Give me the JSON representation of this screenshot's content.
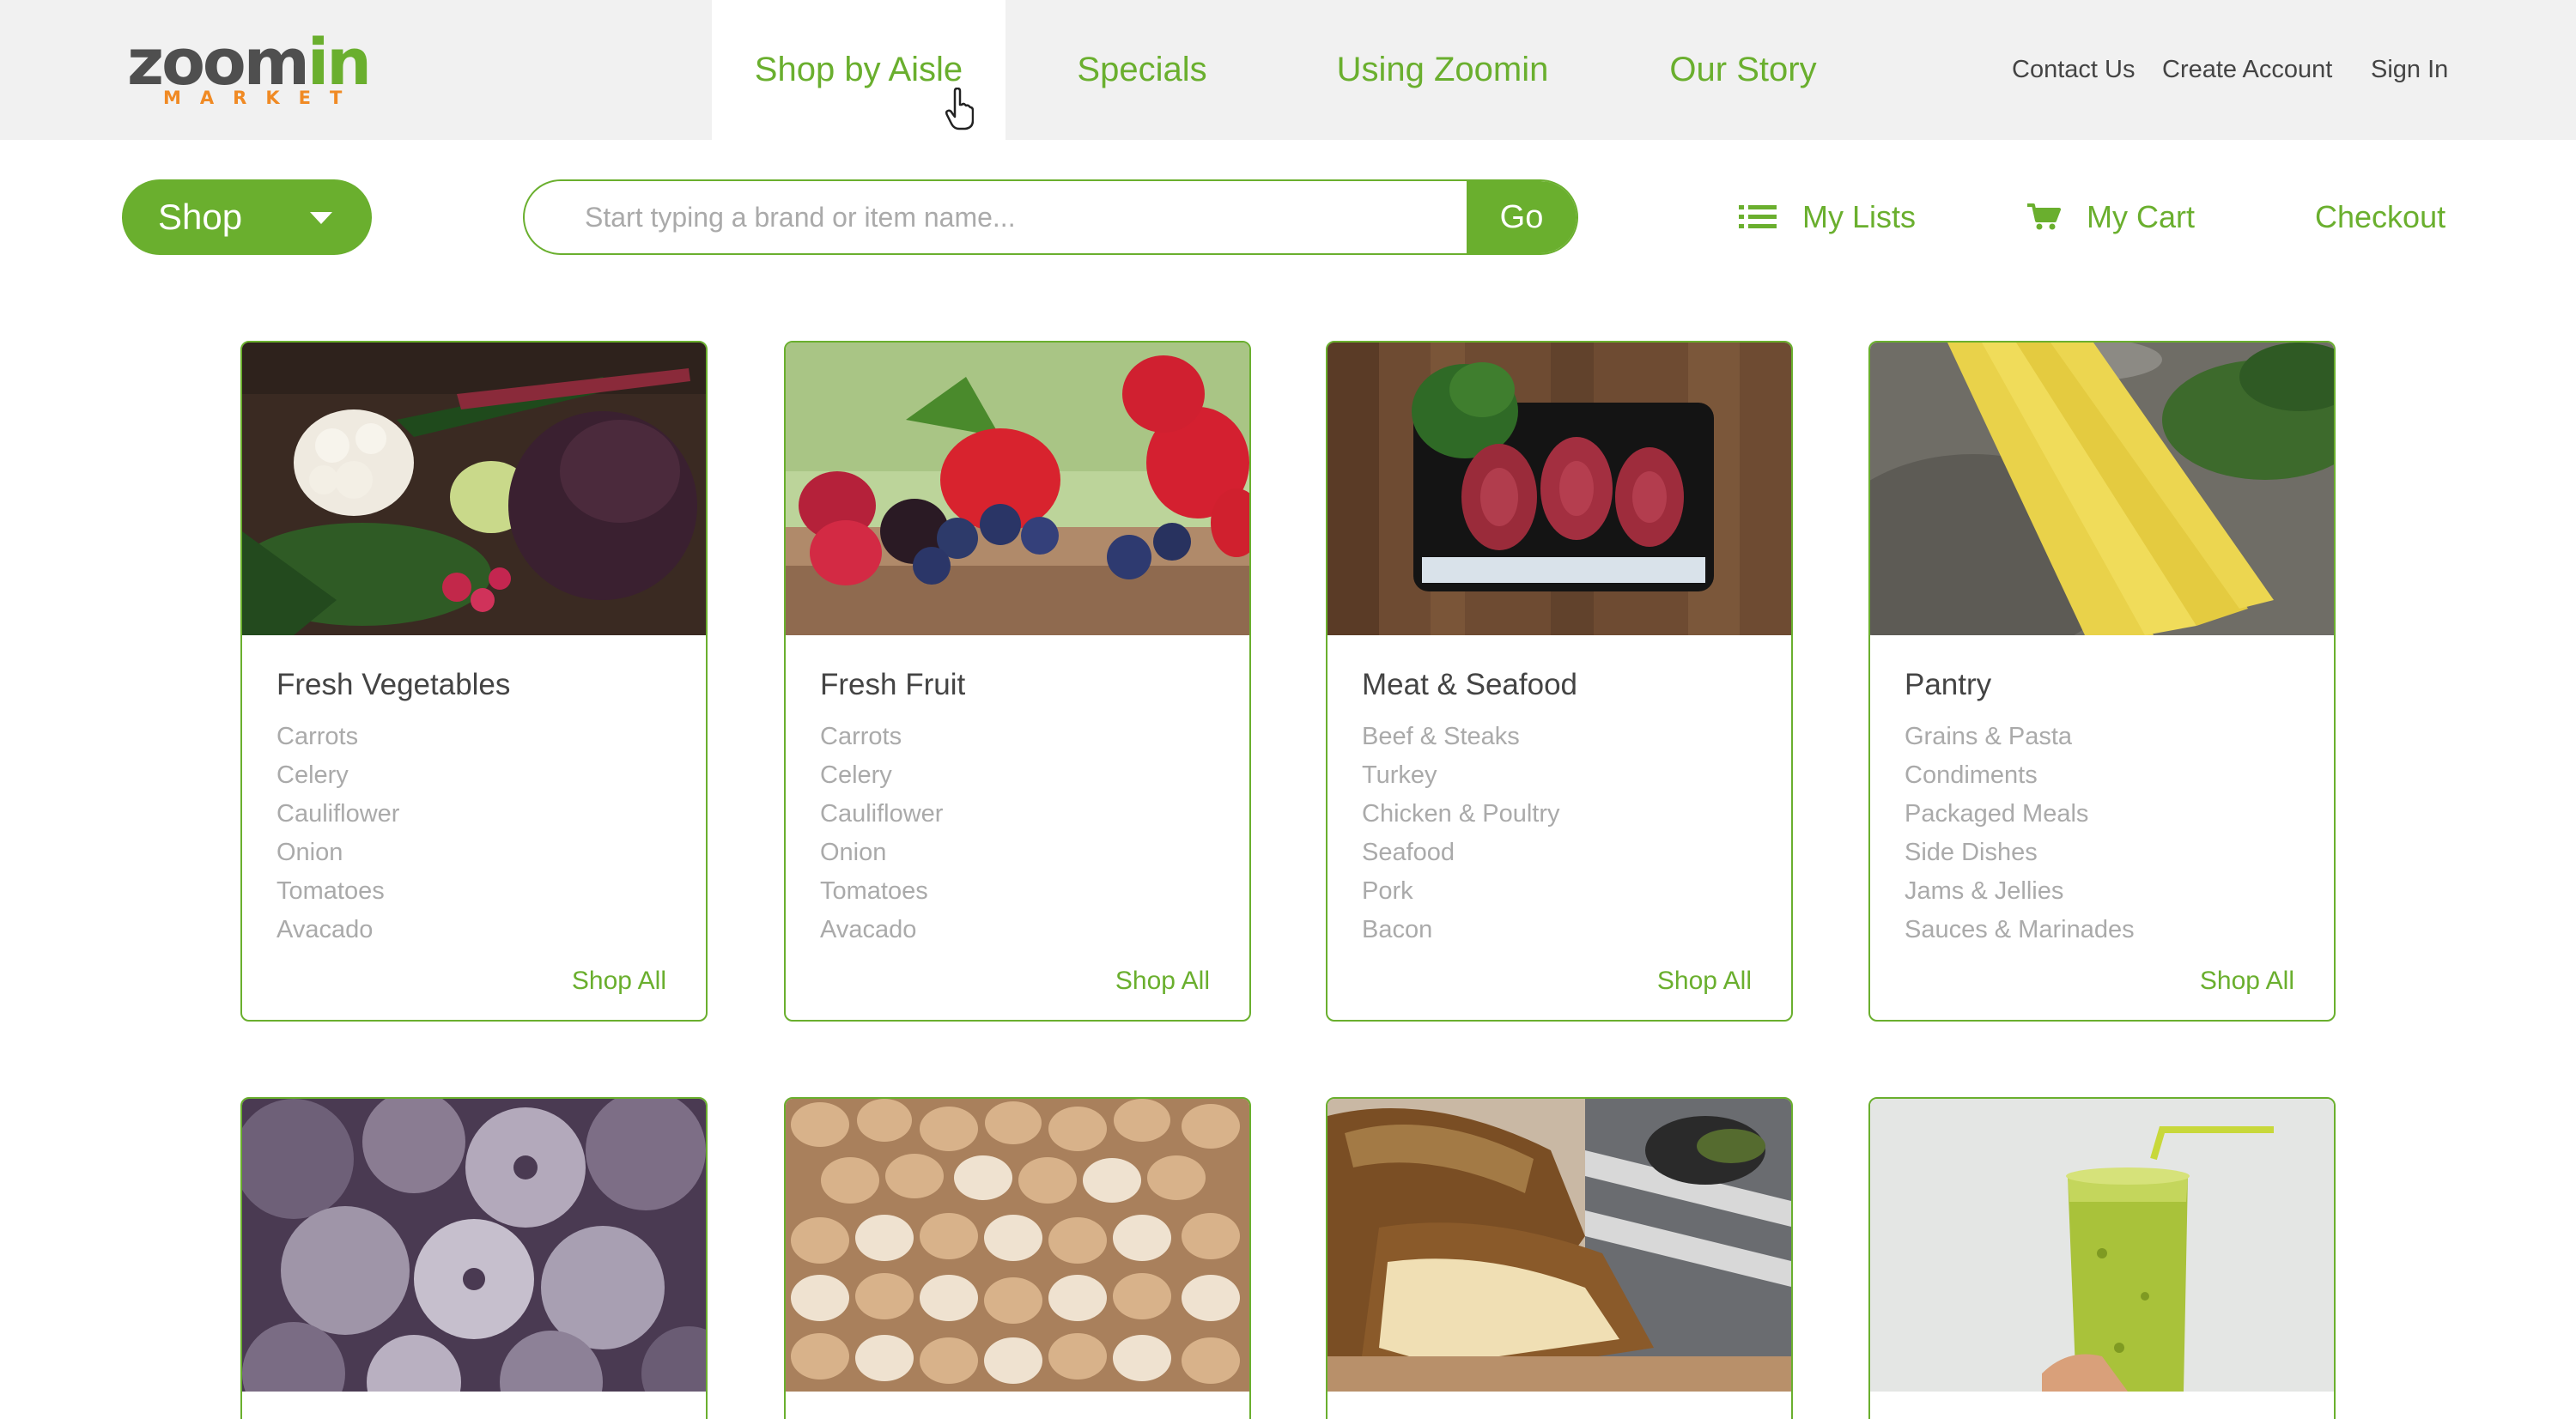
{
  "brand": {
    "name_part1": "zoom",
    "name_part2": "in",
    "sub": "MARKET"
  },
  "nav": {
    "tabs": [
      {
        "label": "Shop by Aisle",
        "active": true
      },
      {
        "label": "Specials",
        "active": false
      },
      {
        "label": "Using Zoomin",
        "active": false
      },
      {
        "label": "Our Story",
        "active": false
      }
    ],
    "util": [
      "Contact Us",
      "Create Account",
      "Sign In"
    ]
  },
  "toolbar": {
    "shop_label": "Shop",
    "search_placeholder": "Start typing a brand or item name...",
    "go_label": "Go",
    "my_lists": "My Lists",
    "my_cart": "My Cart",
    "checkout": "Checkout"
  },
  "icons": {
    "shop_caret": "caret-down-icon",
    "lists": "list-icon",
    "cart": "cart-icon",
    "cursor": "hand-pointer-icon"
  },
  "colors": {
    "accent": "#6aaf2e",
    "logo_gray": "#4f4f4f",
    "logo_orange": "#f08a24",
    "nav_bg": "#f1f1f1"
  },
  "categories": [
    {
      "title": "Fresh Vegetables",
      "items": [
        "Carrots",
        "Celery",
        "Cauliflower",
        "Onion",
        "Tomatoes",
        "Avacado"
      ],
      "shop_all": "Shop All"
    },
    {
      "title": "Fresh Fruit",
      "items": [
        "Carrots",
        "Celery",
        "Cauliflower",
        "Onion",
        "Tomatoes",
        "Avacado"
      ],
      "shop_all": "Shop All"
    },
    {
      "title": "Meat & Seafood",
      "items": [
        "Beef & Steaks",
        "Turkey",
        "Chicken & Poultry",
        "Seafood",
        "Pork",
        "Bacon"
      ],
      "shop_all": "Shop All"
    },
    {
      "title": "Pantry",
      "items": [
        "Grains & Pasta",
        "Condiments",
        "Packaged Meals",
        "Side Dishes",
        "Jams & Jellies",
        "Sauces & Marinades"
      ],
      "shop_all": "Shop All"
    }
  ]
}
